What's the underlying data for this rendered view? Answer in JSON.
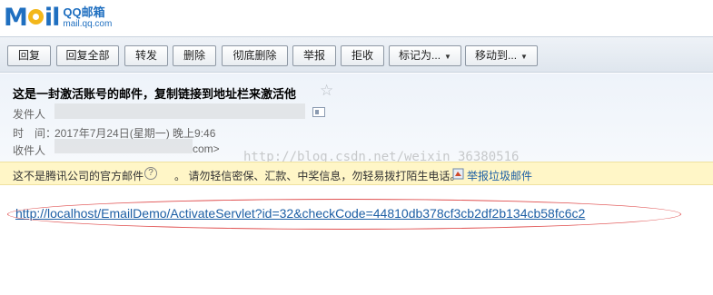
{
  "logo": {
    "mark_m": "M",
    "mark_rest": "il",
    "name_cn": "QQ邮箱",
    "domain": "mail.qq.com"
  },
  "toolbar": {
    "reply": "回复",
    "reply_all": "回复全部",
    "forward": "转发",
    "delete": "删除",
    "delete_permanent": "彻底删除",
    "report": "举报",
    "reject": "拒收",
    "mark_as": "标记为...",
    "move_to": "移动到...",
    "dropdown_glyph": "▼"
  },
  "mail": {
    "subject": "这是一封激活账号的邮件，复制链接到地址栏来激活他",
    "star": "☆",
    "sender_label": "发件人",
    "time_label": "时　间：",
    "time_value": "2017年7月24日(星期一) 晚上9:46",
    "receiver_label": "收件人",
    "receiver_suffix": "com>",
    "watermark": "http://blog.csdn.net/weixin_36380516"
  },
  "warning": {
    "text1": "这不是腾讯公司的官方邮件",
    "help": "?",
    "text2": "。 请勿轻信密保、汇款、中奖信息，勿轻易拨打陌生电话。",
    "report_spam": "举报垃圾邮件"
  },
  "body": {
    "link": "http://localhost/EmailDemo/ActivateServlet?id=32&checkCode=44810db378cf3cb2df2b134cb58fc6c2"
  },
  "colors": {
    "accent": "#1d5fa5",
    "warning_bg": "#fff6c7",
    "annotation": "#e05050"
  }
}
